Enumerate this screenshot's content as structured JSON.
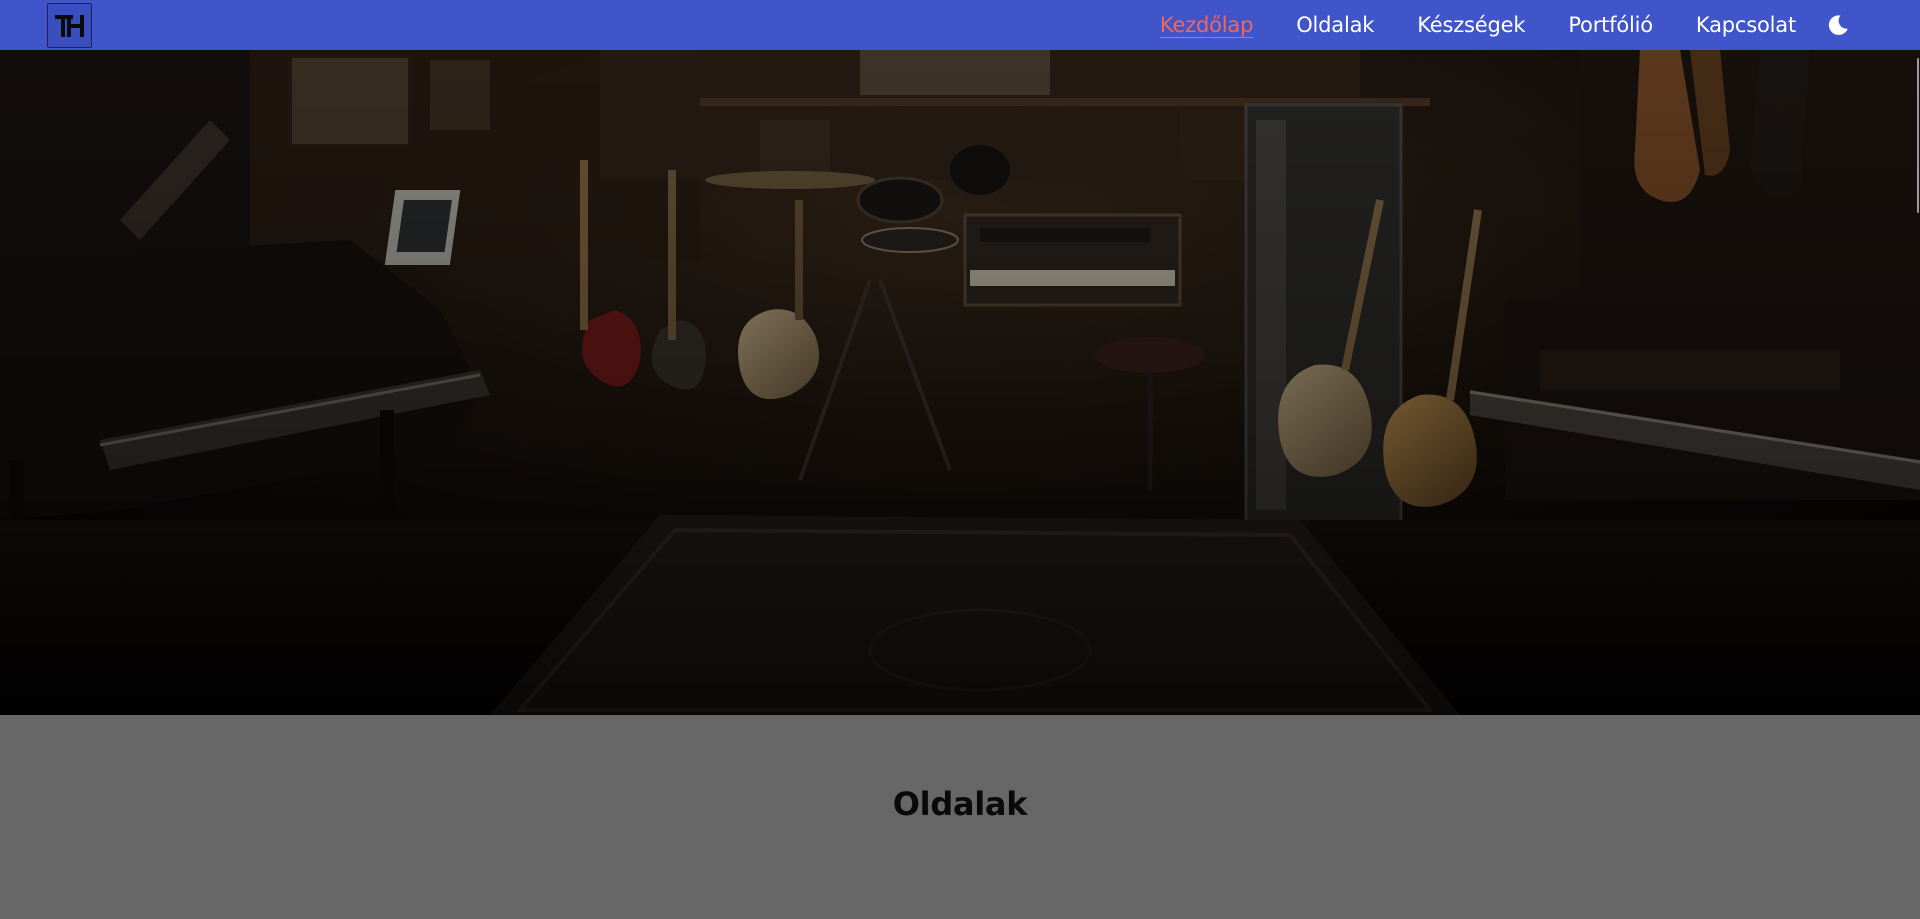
{
  "header": {
    "logo_text": "TH",
    "nav": [
      {
        "label": "Kezdőlap",
        "active": true
      },
      {
        "label": "Oldalak",
        "active": false
      },
      {
        "label": "Készségek",
        "active": false
      },
      {
        "label": "Portfólió",
        "active": false
      },
      {
        "label": "Kapcsolat",
        "active": false
      }
    ],
    "theme_icon": "moon-icon"
  },
  "hero": {
    "image_subject": "music studio with pianos, guitars and drum kit"
  },
  "section": {
    "title": "Oldalak"
  },
  "colors": {
    "navbar": "#3f55c9",
    "active_link": "#f0675c",
    "section_bg": "#666766"
  }
}
